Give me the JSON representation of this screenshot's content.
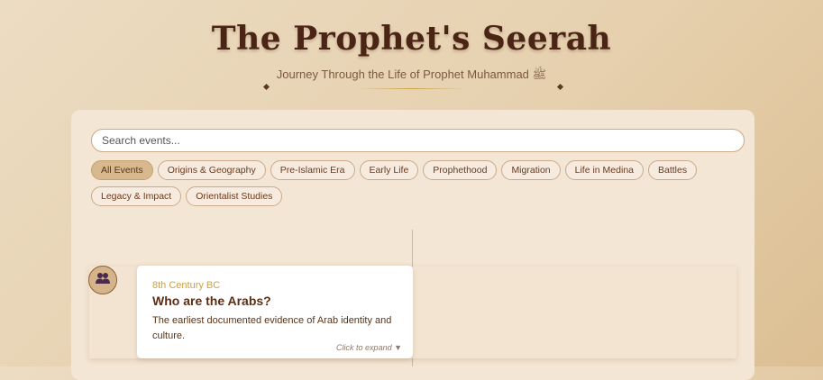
{
  "header": {
    "title": "The Prophet's Seerah",
    "subtitle": "Journey Through the Life of Prophet Muhammad ﷺ"
  },
  "search": {
    "placeholder": "Search events..."
  },
  "filters": {
    "items": [
      "All Events",
      "Origins & Geography",
      "Pre-Islamic Era",
      "Early Life",
      "Prophethood",
      "Migration",
      "Life in Medina",
      "Battles",
      "Legacy & Impact",
      "Orientalist Studies"
    ],
    "active": "All Events"
  },
  "timeline": {
    "events": [
      {
        "icon": "people-icon",
        "date": "8th Century BC",
        "title": "Who are the Arabs?",
        "description": "The earliest documented evidence of Arab identity and culture.",
        "expand_label": "Click to expand ▼"
      }
    ]
  },
  "colors": {
    "title": "#4a2414",
    "accent_gold": "#c9a24a",
    "panel_bg": "#f4e6d4",
    "chip_active_bg": "#d8b88e"
  }
}
